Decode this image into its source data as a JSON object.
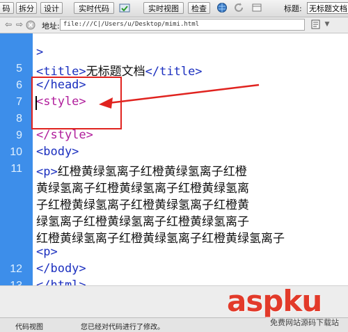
{
  "toolbar": {
    "code_btn": "码",
    "split_btn": "拆分",
    "design_btn": "设计",
    "live_code_btn": "实时代码",
    "live_view_btn": "实时视图",
    "inspect_btn": "检查",
    "title_label": "标题:",
    "title_value": "无标题文档"
  },
  "address": {
    "label": "地址:",
    "value": "file:///C|/Users/u/Desktop/mimi.html"
  },
  "editor": {
    "lines": [
      {
        "num": "",
        "text": ">"
      },
      {
        "num": "5",
        "text": "<title>无标题文档</title>"
      },
      {
        "num": "6",
        "text": "</head>"
      },
      {
        "num": "7",
        "text": "<style>"
      },
      {
        "num": "8",
        "text": ""
      },
      {
        "num": "9",
        "text": "</style>"
      },
      {
        "num": "10",
        "text": "<body>"
      },
      {
        "num": "11",
        "text": "<p>红橙黄绿氢离子红橙黄绿氢离子红橙"
      },
      {
        "num": "",
        "text": "黄绿氢离子红橙黄绿氢离子红橙黄绿氢离"
      },
      {
        "num": "",
        "text": "子红橙黄绿氢离子红橙黄绿氢离子红橙黄"
      },
      {
        "num": "",
        "text": "绿氢离子红橙黄绿氢离子红橙黄绿氢离子"
      },
      {
        "num": "",
        "text": "红橙黄绿氢离子红橙黄绿氢离子红橙黄绿氢离子"
      },
      {
        "num": "",
        "text": "<p>"
      },
      {
        "num": "12",
        "text": "</body>"
      },
      {
        "num": "13",
        "text": "</html>"
      }
    ]
  },
  "status": {
    "left": "代码视图",
    "message": "您已经对代码进行了修改。"
  },
  "watermark": {
    "text": "aspku",
    "sub": "免费网站源码下载站"
  },
  "colors": {
    "gutter": "#3d8eea",
    "tag": "#1b2fbf",
    "style_tag": "#b01c9b",
    "annotation": "#e0231f"
  }
}
